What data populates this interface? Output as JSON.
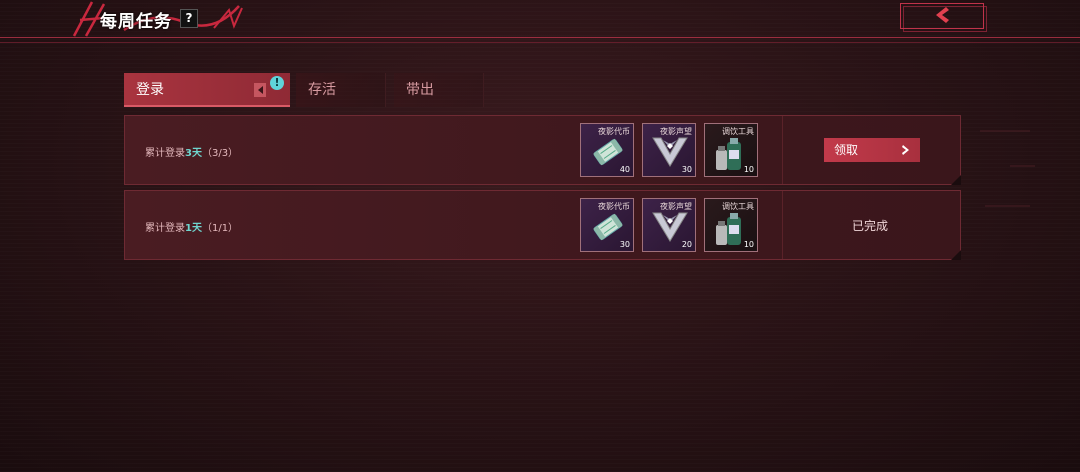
{
  "header": {
    "title": "每周任务",
    "help_glyph": "?",
    "back_icon": "chevron-left-icon"
  },
  "tabs": [
    {
      "label": "登录",
      "active": true,
      "badge": "!"
    },
    {
      "label": "存活",
      "active": false
    },
    {
      "label": "带出",
      "active": false
    }
  ],
  "tasks": [
    {
      "title_prefix": "累计登录",
      "title_highlight": "3天",
      "title_suffix": "（3/3）",
      "rewards": [
        {
          "name": "夜影代币",
          "count": "40",
          "icon": "token-icon"
        },
        {
          "name": "夜影声望",
          "count": "30",
          "icon": "reputation-icon"
        },
        {
          "name": "调饮工具",
          "count": "10",
          "icon": "drink-tool-icon"
        }
      ],
      "action_label": "领取",
      "status": "claimable"
    },
    {
      "title_prefix": "累计登录",
      "title_highlight": "1天",
      "title_suffix": "（1/1）",
      "rewards": [
        {
          "name": "夜影代币",
          "count": "30",
          "icon": "token-icon"
        },
        {
          "name": "夜影声望",
          "count": "20",
          "icon": "reputation-icon"
        },
        {
          "name": "调饮工具",
          "count": "10",
          "icon": "drink-tool-icon"
        }
      ],
      "action_label": "已完成",
      "status": "completed"
    }
  ],
  "colors": {
    "accent": "#c23a4a",
    "highlight": "#6fd6cf",
    "background": "#2a1316"
  }
}
